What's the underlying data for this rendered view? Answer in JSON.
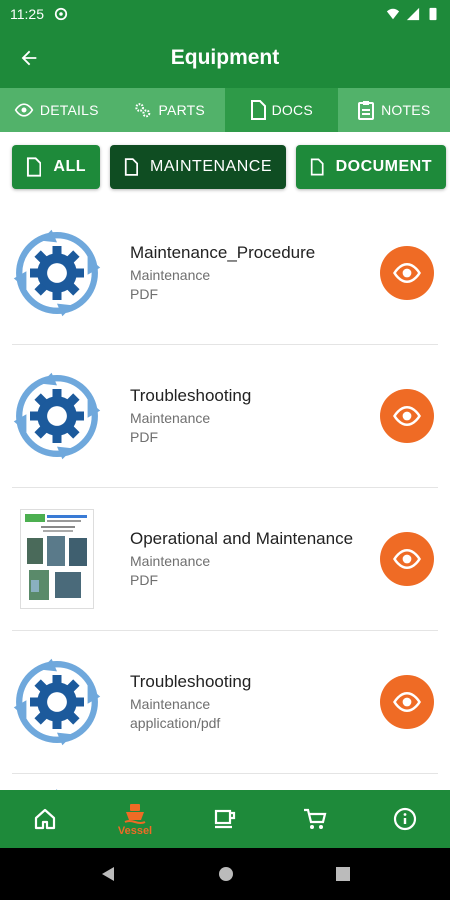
{
  "status_bar": {
    "time": "11:25"
  },
  "app_bar": {
    "title": "Equipment"
  },
  "tabs": [
    {
      "label": "DETAILS",
      "icon": "eye-icon"
    },
    {
      "label": "PARTS",
      "icon": "gears-icon"
    },
    {
      "label": "DOCS",
      "icon": "document-icon"
    },
    {
      "label": "NOTES",
      "icon": "clipboard-icon"
    }
  ],
  "filters": [
    {
      "label": "ALL"
    },
    {
      "label": "MAINTENANCE"
    },
    {
      "label": "DOCUMENT"
    }
  ],
  "documents": [
    {
      "title": "Maintenance_Procedure",
      "category": "Maintenance",
      "type": "PDF",
      "thumb": "gear-cycle"
    },
    {
      "title": "Troubleshooting",
      "category": "Maintenance",
      "type": "PDF",
      "thumb": "gear-cycle"
    },
    {
      "title": "Operational and Maintenance",
      "category": "Maintenance",
      "type": "PDF",
      "thumb": "brochure"
    },
    {
      "title": "Troubleshooting",
      "category": "Maintenance",
      "type": "application/pdf",
      "thumb": "gear-cycle"
    }
  ],
  "bottom_nav": [
    {
      "name": "home",
      "icon": "home-icon",
      "label": ""
    },
    {
      "name": "vessel",
      "icon": "ship-icon",
      "label": "Vessel"
    },
    {
      "name": "cafe",
      "icon": "coffee-icon",
      "label": ""
    },
    {
      "name": "cart",
      "icon": "cart-icon",
      "label": ""
    },
    {
      "name": "info",
      "icon": "info-icon",
      "label": ""
    }
  ],
  "colors": {
    "primary": "#1e8a3a",
    "tab_bar": "#52b26a",
    "selected_filter": "#0f4d22",
    "accent": "#ef6b25"
  }
}
